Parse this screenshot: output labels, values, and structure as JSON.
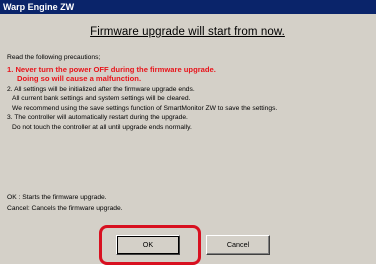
{
  "window": {
    "title": "Warp Engine ZW"
  },
  "dialog": {
    "heading": "Firmware upgrade will start from now.",
    "intro": "Read the following precautions;",
    "warning1": "1. Never turn the power OFF during the firmware upgrade.",
    "warning2": "Doing so will cause a malfunction.",
    "p2a": "2. All settings will be initialized after the firmware upgrade ends.",
    "p2b": "All current bank settings and system settings will be cleared.",
    "p2c": "We recommend using the save settings function of SmartMonitor ZW to save the settings.",
    "p3a": "3. The controller will automatically restart during the upgrade.",
    "p3b": "Do not touch the controller at all until upgrade ends normally.",
    "ok_hint": "OK    : Starts the firmware upgrade.",
    "cancel_hint": "Cancel: Cancels the firmware upgrade."
  },
  "buttons": {
    "ok": "OK",
    "cancel": "Cancel"
  },
  "colors": {
    "title_bar": "#0a246a",
    "warning": "#e8141b",
    "highlight": "#d81020",
    "face": "#d4d0c8"
  }
}
